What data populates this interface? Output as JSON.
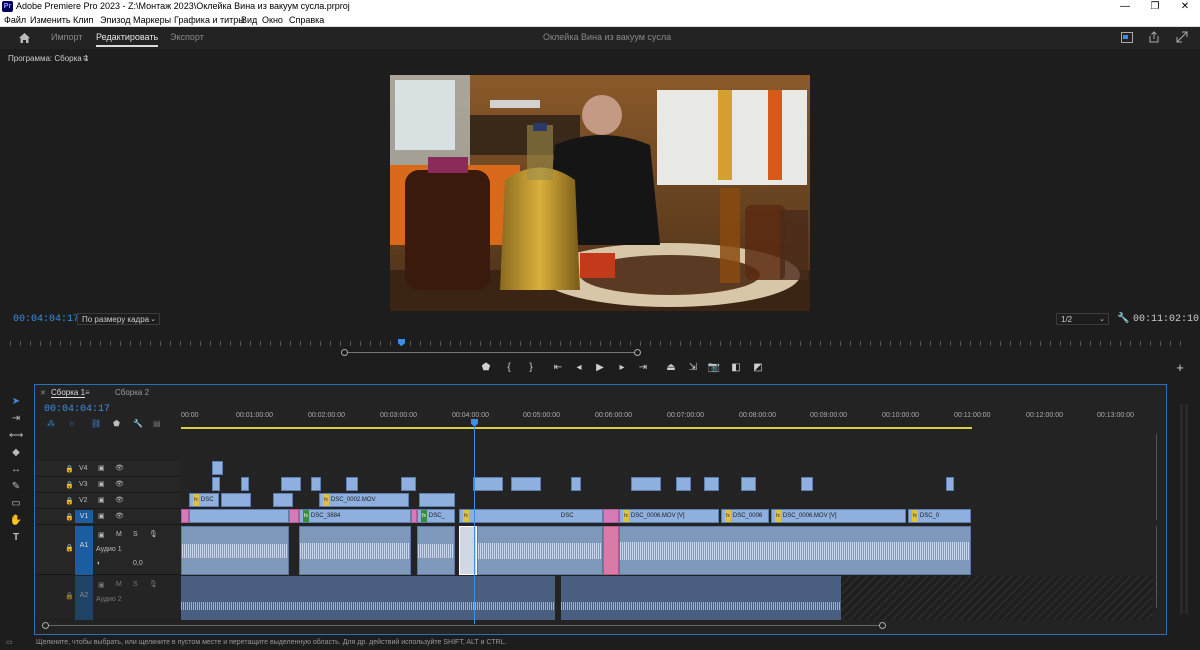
{
  "window": {
    "title": "Adobe Premiere Pro 2023 - Z:\\Монтаж 2023\\Оклейка Вина из вакуум сусла.prproj",
    "logo": "Pr",
    "controls": {
      "minimize": "—",
      "maximize": "❐",
      "close": "✕"
    }
  },
  "menu": [
    "Файл",
    "Изменить",
    "Клип",
    "Эпизод",
    "Маркеры",
    "Графика и титры",
    "Вид",
    "Окно",
    "Справка"
  ],
  "header": {
    "tabs": [
      "Импорт",
      "Редактировать",
      "Экспорт"
    ],
    "active_tab": "Редактировать",
    "project_title": "Оклейка Вина из вакуум сусла"
  },
  "program_monitor": {
    "panel_title": "Программа: Сборка 1",
    "menu_icon": "≡",
    "current_timecode": "00:04:04:17",
    "fit_label": "По размеру кадра",
    "resolution": "1/2",
    "duration": "00:11:02:10"
  },
  "timeline": {
    "tabs": [
      "Сборка 1",
      "Сборка 2"
    ],
    "active_tab": "Сборка 1",
    "timecode": "00:04:04:17",
    "ruler": [
      "00:00",
      "00:01:00:00",
      "00:02:00:00",
      "00:03:00:00",
      "00:04:00:00",
      "00:05:00:00",
      "00:06:00:00",
      "00:07:00:00",
      "00:08:00:00",
      "00:09:00:00",
      "00:10:00:00",
      "00:11:00:00",
      "00:12:00:00",
      "00:13:00:00"
    ],
    "video_tracks": [
      "V4",
      "V3",
      "V2",
      "V1"
    ],
    "audio_tracks": [
      {
        "id": "A1",
        "name": "Аудио 1",
        "volume": "0,0"
      },
      {
        "id": "A2",
        "name": "Аудио 2"
      }
    ],
    "m_label": "M",
    "s_label": "S",
    "clips": {
      "v2": [
        "DSC",
        "DSC_0002.MOV",
        "DSC"
      ],
      "v1": [
        "DSC_3884",
        "DSC_",
        "DSC",
        "DSC_0006.MOV [V]",
        "DSC_0006",
        "DSC_0006.MOV [V]",
        "DSC_0"
      ]
    }
  },
  "status_bar": "Щелкните, чтобы выбрать, или щелкните в пустом месте и перетащите выделенную область. Для др. действий используйте SHIFT, ALT и CTRL.",
  "colors": {
    "accent": "#3a8ee6",
    "video_clip": "#8fb0de",
    "pink_clip": "#d67bb8",
    "audio_clip": "#7f99bd"
  }
}
